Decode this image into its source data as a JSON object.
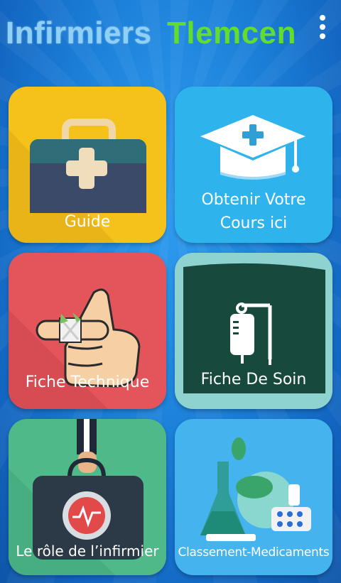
{
  "app": {
    "title_part1": "Infirmiers",
    "title_part2": "Tlemcen",
    "colors": {
      "title_part1": "#8fd0f6",
      "title_part2": "#62dd2e",
      "background": "#1b7fd8"
    }
  },
  "menu": {
    "icon": "more-vert-icon"
  },
  "tiles": [
    {
      "label": "Guide",
      "icon": "first-aid-kit-icon",
      "color": "#f4c21b"
    },
    {
      "label_line1": "Obtenir Votre",
      "label_line2": "Cours ici",
      "icon": "graduation-cap-icon",
      "color": "#2fb3ec"
    },
    {
      "label": "Fiche Technique",
      "icon": "bandaged-hand-icon",
      "color": "#e4555b"
    },
    {
      "label": "Fiche De Soin",
      "icon": "iv-drip-icon",
      "color": "#8fd3d0"
    },
    {
      "label": "Le rôle de l’infirmier",
      "icon": "medical-bag-heart-icon",
      "color": "#4fb98a"
    },
    {
      "label": "Classement-Medicaments",
      "icon": "lab-flask-icon",
      "color": "#45b3ee"
    }
  ]
}
